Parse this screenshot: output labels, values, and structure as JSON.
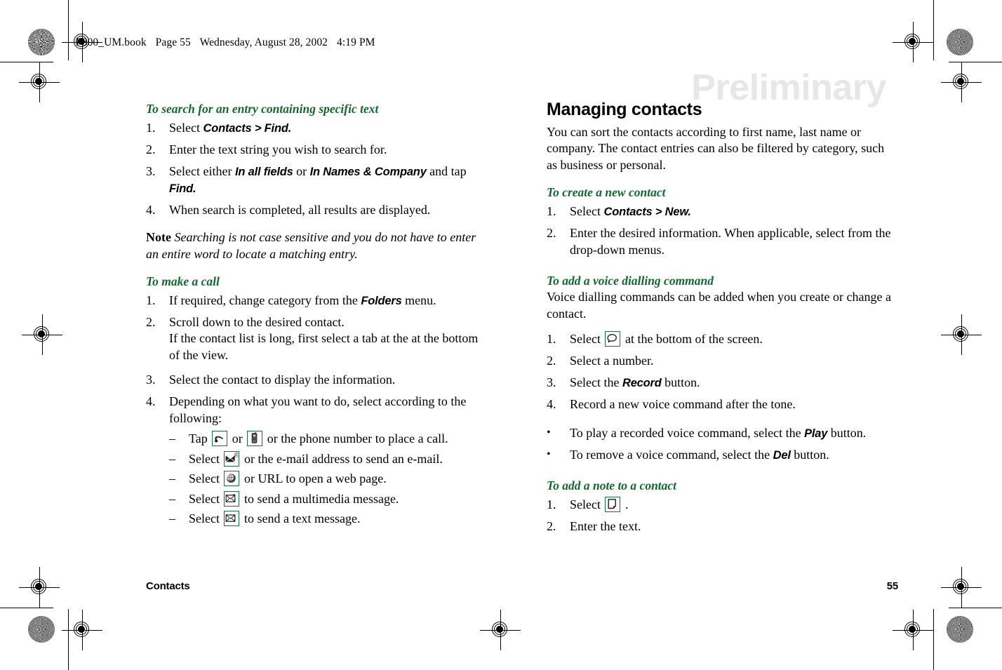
{
  "header": {
    "slug_file": "P800_UM.book",
    "slug_page": "Page 55",
    "slug_date": "Wednesday, August 28, 2002",
    "slug_time": "4:19 PM"
  },
  "watermark": "Preliminary",
  "colors": {
    "heading_green": "#14682f",
    "icon_border_green": "#1d6b45",
    "watermark_gray": "#e7e7e7"
  },
  "left_column": {
    "search_heading": "To search for an entry containing specific text",
    "search_steps": [
      {
        "num": "1.",
        "pre": "Select ",
        "ui": "Contacts > Find.",
        "post": ""
      },
      {
        "num": "2.",
        "pre": "Enter the text string you wish to search for.",
        "ui": "",
        "post": ""
      },
      {
        "num": "3.",
        "pre": "Select either ",
        "ui": "In all fields",
        "mid": " or ",
        "ui2": "In Names & Company",
        "mid2": " and tap ",
        "ui3": "Find.",
        "post": ""
      },
      {
        "num": "4.",
        "pre": "When search is completed, all results are displayed.",
        "ui": "",
        "post": ""
      }
    ],
    "note_label": "Note",
    "note_text": "Searching is not case sensitive and you do not have to enter an entire word to locate a matching entry.",
    "call_heading": "To make a call",
    "call_steps": [
      {
        "num": "1.",
        "pre": "If required, change category from the ",
        "ui": "Folders",
        "post": " menu."
      },
      {
        "num": "2.",
        "pre": "Scroll down to the desired contact.",
        "cont": "If the contact list is long, first select a tab at the at the bottom of the view."
      },
      {
        "num": "3.",
        "pre": "Select the contact to display the information."
      },
      {
        "num": "4.",
        "pre": "Depending on what you want to do, select according to the following:"
      }
    ],
    "call_options": [
      {
        "dash": "–",
        "pre": "Tap ",
        "icon": "phone-handset-icon",
        "mid": " or ",
        "icon2": "mobile-phone-icon",
        "post": " or the phone number to place a call."
      },
      {
        "dash": "–",
        "pre": "Select ",
        "icon": "email-envelope-icon",
        "post": " or the e-mail address to send an e-mail."
      },
      {
        "dash": "–",
        "pre": "Select ",
        "icon": "globe-web-icon",
        "post": " or URL to open a web page."
      },
      {
        "dash": "–",
        "pre": "Select ",
        "icon": "mms-envelope-icon",
        "post": " to send a multimedia message."
      },
      {
        "dash": "–",
        "pre": "Select ",
        "icon": "sms-envelope-icon",
        "post": " to send a text message."
      }
    ]
  },
  "right_column": {
    "section_title": "Managing contacts",
    "intro": "You can sort the contacts according to first name, last name or company. The contact entries can also be filtered by category, such as business or personal.",
    "create_heading": "To create a new contact",
    "create_steps": [
      {
        "num": "1.",
        "pre": "Select ",
        "ui": "Contacts > New.",
        "post": ""
      },
      {
        "num": "2.",
        "pre": "Enter the desired information. When applicable, select from the drop-down menus.",
        "ui": "",
        "post": ""
      }
    ],
    "voice_heading": "To add a voice dialling command",
    "voice_intro": "Voice dialling commands can be added when you create or change a contact.",
    "voice_steps": [
      {
        "num": "1.",
        "pre": "Select ",
        "icon": "speech-bubble-icon",
        "post": " at the bottom of the screen."
      },
      {
        "num": "2.",
        "pre": "Select a number.",
        "post": ""
      },
      {
        "num": "3.",
        "pre": "Select the ",
        "ui": "Record",
        "post": " button."
      },
      {
        "num": "4.",
        "pre": "Record a new voice command after the tone.",
        "post": ""
      }
    ],
    "voice_bullets": [
      {
        "bullet": "•",
        "pre": "To play a recorded voice command, select the ",
        "ui": "Play",
        "post": " button."
      },
      {
        "bullet": "•",
        "pre": "To remove a voice command, select the ",
        "ui": "Del",
        "post": " button."
      }
    ],
    "note_heading": "To add a note to a contact",
    "note_steps": [
      {
        "num": "1.",
        "pre": "Select ",
        "icon": "note-page-icon",
        "post": " ."
      },
      {
        "num": "2.",
        "pre": "Enter the text.",
        "post": ""
      }
    ]
  },
  "footer": {
    "chapter": "Contacts",
    "page_number": "55"
  }
}
